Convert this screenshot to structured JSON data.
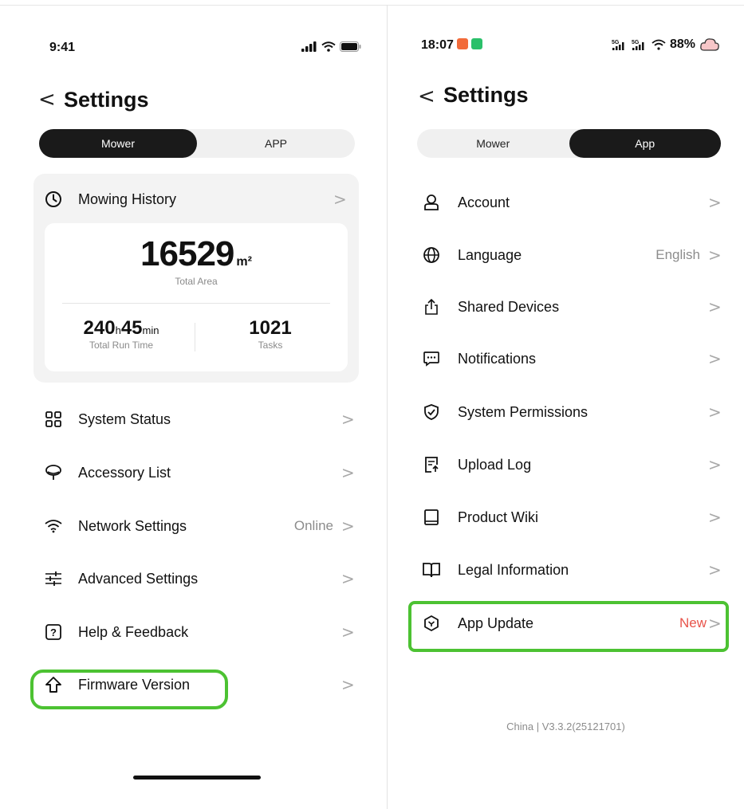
{
  "mower_screen": {
    "status_bar": {
      "time": "9:41"
    },
    "back_label": "<",
    "title": "Settings",
    "segments": [
      {
        "label": "Mower",
        "active": true
      },
      {
        "label": "APP",
        "active": false
      }
    ],
    "history": {
      "label": "Mowing History",
      "total_area": "16529",
      "area_unit": "m²",
      "total_area_label": "Total Area",
      "run_hours": "240",
      "hours_unit": "h",
      "run_minutes": "45",
      "minutes_unit": "min",
      "run_time_label": "Total Run Time",
      "tasks": "1021",
      "tasks_label": "Tasks"
    },
    "items": [
      {
        "label": "System Status",
        "icon": "grid-icon",
        "value": ""
      },
      {
        "label": "Accessory List",
        "icon": "accessory-icon",
        "value": ""
      },
      {
        "label": "Network Settings",
        "icon": "wifi-icon",
        "value": "Online"
      },
      {
        "label": "Advanced Settings",
        "icon": "sliders-icon",
        "value": ""
      },
      {
        "label": "Help & Feedback",
        "icon": "help-icon",
        "value": ""
      },
      {
        "label": "Firmware Version",
        "icon": "upgrade-arrow-icon",
        "value": ""
      }
    ],
    "chevron": ">"
  },
  "app_screen": {
    "status_bar": {
      "time": "18:07",
      "battery": "88%",
      "network": "5G"
    },
    "back_label": "<",
    "title": "Settings",
    "segments": [
      {
        "label": "Mower",
        "active": false
      },
      {
        "label": "App",
        "active": true
      }
    ],
    "items": [
      {
        "label": "Account",
        "icon": "user-icon",
        "value": ""
      },
      {
        "label": "Language",
        "icon": "globe-icon",
        "value": "English"
      },
      {
        "label": "Shared Devices",
        "icon": "share-icon",
        "value": ""
      },
      {
        "label": "Notifications",
        "icon": "message-icon",
        "value": ""
      },
      {
        "label": "System Permissions",
        "icon": "shield-check-icon",
        "value": ""
      },
      {
        "label": "Upload Log",
        "icon": "upload-log-icon",
        "value": ""
      },
      {
        "label": "Product Wiki",
        "icon": "book-icon",
        "value": ""
      },
      {
        "label": "Legal Information",
        "icon": "open-book-icon",
        "value": ""
      },
      {
        "label": "App Update",
        "icon": "update-icon",
        "value": "New"
      }
    ],
    "footer": "China  |  V3.3.2(25121701)",
    "chevron": ">"
  },
  "colors": {
    "highlight": "#4cc232",
    "new_badge": "#e8534a",
    "active_segment": "#1a1a1a"
  }
}
